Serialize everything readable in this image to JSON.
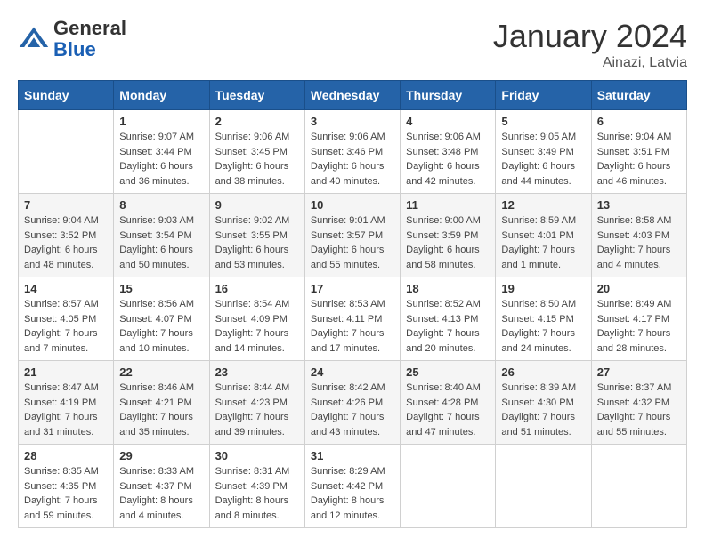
{
  "header": {
    "logo": {
      "general": "General",
      "blue": "Blue"
    },
    "title": "January 2024",
    "location": "Ainazi, Latvia"
  },
  "days_of_week": [
    "Sunday",
    "Monday",
    "Tuesday",
    "Wednesday",
    "Thursday",
    "Friday",
    "Saturday"
  ],
  "weeks": [
    [
      {
        "day": "",
        "info": ""
      },
      {
        "day": "1",
        "info": "Sunrise: 9:07 AM\nSunset: 3:44 PM\nDaylight: 6 hours\nand 36 minutes."
      },
      {
        "day": "2",
        "info": "Sunrise: 9:06 AM\nSunset: 3:45 PM\nDaylight: 6 hours\nand 38 minutes."
      },
      {
        "day": "3",
        "info": "Sunrise: 9:06 AM\nSunset: 3:46 PM\nDaylight: 6 hours\nand 40 minutes."
      },
      {
        "day": "4",
        "info": "Sunrise: 9:06 AM\nSunset: 3:48 PM\nDaylight: 6 hours\nand 42 minutes."
      },
      {
        "day": "5",
        "info": "Sunrise: 9:05 AM\nSunset: 3:49 PM\nDaylight: 6 hours\nand 44 minutes."
      },
      {
        "day": "6",
        "info": "Sunrise: 9:04 AM\nSunset: 3:51 PM\nDaylight: 6 hours\nand 46 minutes."
      }
    ],
    [
      {
        "day": "7",
        "info": "Sunrise: 9:04 AM\nSunset: 3:52 PM\nDaylight: 6 hours\nand 48 minutes."
      },
      {
        "day": "8",
        "info": "Sunrise: 9:03 AM\nSunset: 3:54 PM\nDaylight: 6 hours\nand 50 minutes."
      },
      {
        "day": "9",
        "info": "Sunrise: 9:02 AM\nSunset: 3:55 PM\nDaylight: 6 hours\nand 53 minutes."
      },
      {
        "day": "10",
        "info": "Sunrise: 9:01 AM\nSunset: 3:57 PM\nDaylight: 6 hours\nand 55 minutes."
      },
      {
        "day": "11",
        "info": "Sunrise: 9:00 AM\nSunset: 3:59 PM\nDaylight: 6 hours\nand 58 minutes."
      },
      {
        "day": "12",
        "info": "Sunrise: 8:59 AM\nSunset: 4:01 PM\nDaylight: 7 hours\nand 1 minute."
      },
      {
        "day": "13",
        "info": "Sunrise: 8:58 AM\nSunset: 4:03 PM\nDaylight: 7 hours\nand 4 minutes."
      }
    ],
    [
      {
        "day": "14",
        "info": "Sunrise: 8:57 AM\nSunset: 4:05 PM\nDaylight: 7 hours\nand 7 minutes."
      },
      {
        "day": "15",
        "info": "Sunrise: 8:56 AM\nSunset: 4:07 PM\nDaylight: 7 hours\nand 10 minutes."
      },
      {
        "day": "16",
        "info": "Sunrise: 8:54 AM\nSunset: 4:09 PM\nDaylight: 7 hours\nand 14 minutes."
      },
      {
        "day": "17",
        "info": "Sunrise: 8:53 AM\nSunset: 4:11 PM\nDaylight: 7 hours\nand 17 minutes."
      },
      {
        "day": "18",
        "info": "Sunrise: 8:52 AM\nSunset: 4:13 PM\nDaylight: 7 hours\nand 20 minutes."
      },
      {
        "day": "19",
        "info": "Sunrise: 8:50 AM\nSunset: 4:15 PM\nDaylight: 7 hours\nand 24 minutes."
      },
      {
        "day": "20",
        "info": "Sunrise: 8:49 AM\nSunset: 4:17 PM\nDaylight: 7 hours\nand 28 minutes."
      }
    ],
    [
      {
        "day": "21",
        "info": "Sunrise: 8:47 AM\nSunset: 4:19 PM\nDaylight: 7 hours\nand 31 minutes."
      },
      {
        "day": "22",
        "info": "Sunrise: 8:46 AM\nSunset: 4:21 PM\nDaylight: 7 hours\nand 35 minutes."
      },
      {
        "day": "23",
        "info": "Sunrise: 8:44 AM\nSunset: 4:23 PM\nDaylight: 7 hours\nand 39 minutes."
      },
      {
        "day": "24",
        "info": "Sunrise: 8:42 AM\nSunset: 4:26 PM\nDaylight: 7 hours\nand 43 minutes."
      },
      {
        "day": "25",
        "info": "Sunrise: 8:40 AM\nSunset: 4:28 PM\nDaylight: 7 hours\nand 47 minutes."
      },
      {
        "day": "26",
        "info": "Sunrise: 8:39 AM\nSunset: 4:30 PM\nDaylight: 7 hours\nand 51 minutes."
      },
      {
        "day": "27",
        "info": "Sunrise: 8:37 AM\nSunset: 4:32 PM\nDaylight: 7 hours\nand 55 minutes."
      }
    ],
    [
      {
        "day": "28",
        "info": "Sunrise: 8:35 AM\nSunset: 4:35 PM\nDaylight: 7 hours\nand 59 minutes."
      },
      {
        "day": "29",
        "info": "Sunrise: 8:33 AM\nSunset: 4:37 PM\nDaylight: 8 hours\nand 4 minutes."
      },
      {
        "day": "30",
        "info": "Sunrise: 8:31 AM\nSunset: 4:39 PM\nDaylight: 8 hours\nand 8 minutes."
      },
      {
        "day": "31",
        "info": "Sunrise: 8:29 AM\nSunset: 4:42 PM\nDaylight: 8 hours\nand 12 minutes."
      },
      {
        "day": "",
        "info": ""
      },
      {
        "day": "",
        "info": ""
      },
      {
        "day": "",
        "info": ""
      }
    ]
  ]
}
